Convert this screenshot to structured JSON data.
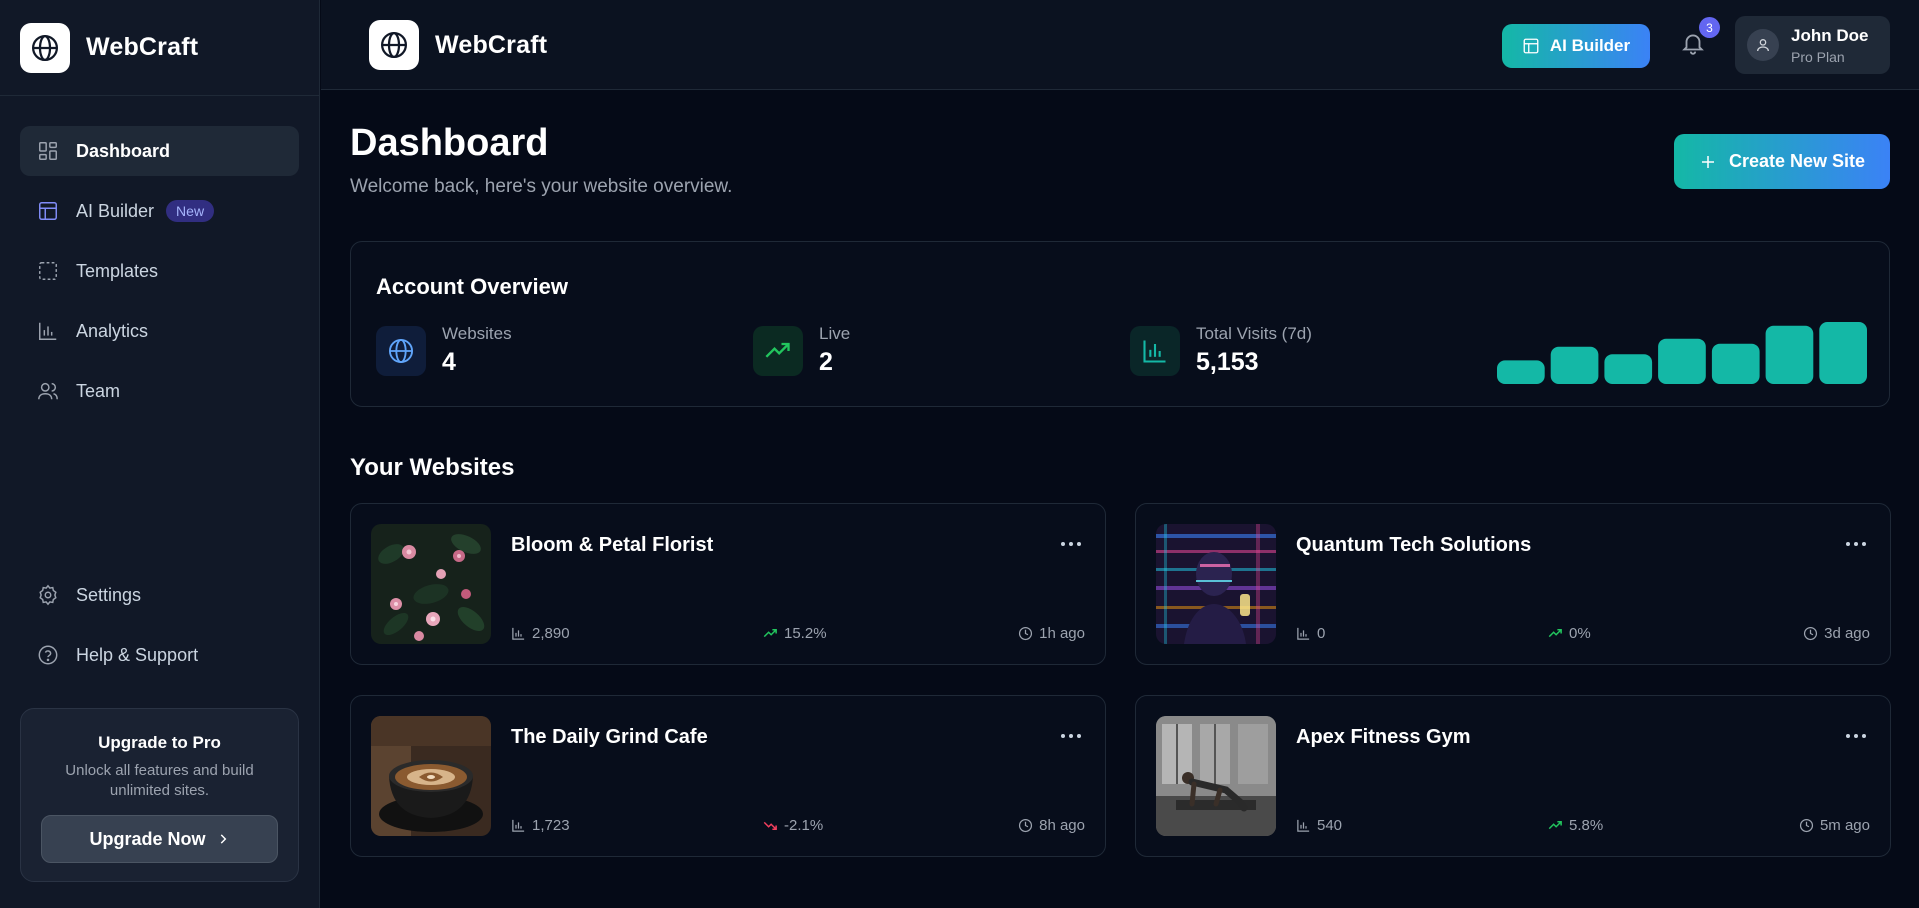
{
  "brand": {
    "name": "WebCraft"
  },
  "sidebar": {
    "items": [
      {
        "label": "Dashboard",
        "icon": "dashboard-icon",
        "active": true
      },
      {
        "label": "AI Builder",
        "icon": "layout-icon",
        "badge": "New"
      },
      {
        "label": "Templates",
        "icon": "templates-icon"
      },
      {
        "label": "Analytics",
        "icon": "bar-chart-icon"
      },
      {
        "label": "Team",
        "icon": "users-icon"
      }
    ],
    "bottom_items": [
      {
        "label": "Settings",
        "icon": "gear-icon"
      },
      {
        "label": "Help & Support",
        "icon": "help-icon"
      }
    ],
    "upgrade": {
      "title": "Upgrade to Pro",
      "description": "Unlock all features and build unlimited sites.",
      "button": "Upgrade Now"
    }
  },
  "header": {
    "ai_builder_label": "AI Builder",
    "notification_count": "3",
    "user": {
      "name": "John Doe",
      "plan": "Pro Plan"
    }
  },
  "page": {
    "title": "Dashboard",
    "subtitle": "Welcome back, here's your website overview.",
    "create_button": "Create New Site"
  },
  "overview": {
    "title": "Account Overview",
    "stats": [
      {
        "label": "Websites",
        "value": "4",
        "icon": "globe-icon"
      },
      {
        "label": "Live",
        "value": "2",
        "icon": "trend-up-icon"
      },
      {
        "label": "Total Visits (7d)",
        "value": "5,153",
        "icon": "bar-chart-icon"
      }
    ],
    "chart_data": {
      "type": "bar",
      "values": [
        0.38,
        0.6,
        0.48,
        0.73,
        0.65,
        0.94,
        1.0
      ],
      "color": "#14b8a6"
    }
  },
  "websites": {
    "title": "Your Websites",
    "items": [
      {
        "name": "Bloom & Petal Florist",
        "visits": "2,890",
        "trend": "15.2%",
        "trend_dir": "up",
        "updated": "1h ago",
        "thumb": "florist"
      },
      {
        "name": "Quantum Tech Solutions",
        "visits": "0",
        "trend": "0%",
        "trend_dir": "up",
        "updated": "3d ago",
        "thumb": "tech"
      },
      {
        "name": "The Daily Grind Cafe",
        "visits": "1,723",
        "trend": "-2.1%",
        "trend_dir": "down",
        "updated": "8h ago",
        "thumb": "cafe"
      },
      {
        "name": "Apex Fitness Gym",
        "visits": "540",
        "trend": "5.8%",
        "trend_dir": "up",
        "updated": "5m ago",
        "thumb": "gym"
      }
    ]
  },
  "colors": {
    "accent": "#14b8a6",
    "accent2": "#3b82f6",
    "up": "#22c55e",
    "down": "#f43f5e",
    "badge": "#6366f1"
  }
}
